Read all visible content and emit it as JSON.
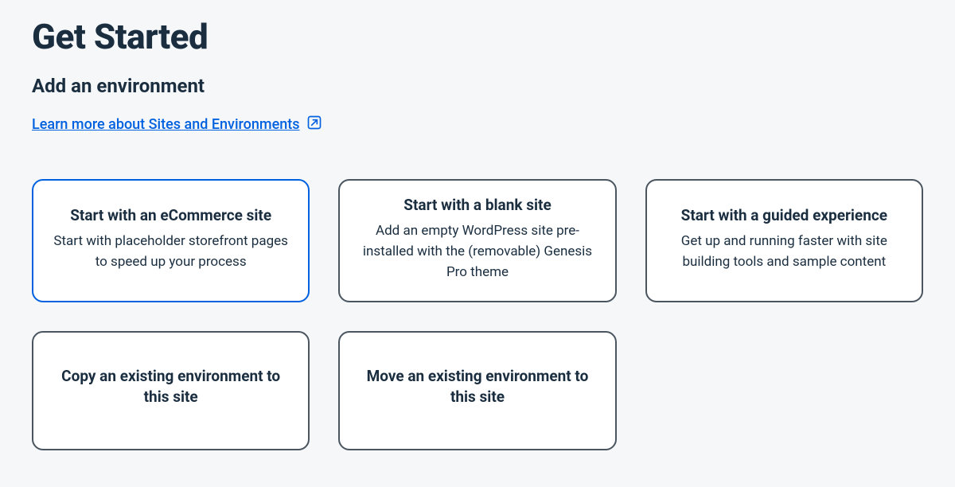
{
  "header": {
    "title": "Get Started",
    "subtitle": "Add an environment",
    "learn_link": "Learn more about Sites and Environments"
  },
  "cards": [
    {
      "title": "Start with an eCommerce site",
      "desc": "Start with placeholder storefront pages to speed up your process",
      "selected": true
    },
    {
      "title": "Start with a blank site",
      "desc": "Add an empty WordPress site pre-installed with the (removable) Genesis Pro theme",
      "selected": false
    },
    {
      "title": "Start with a guided experience",
      "desc": "Get up and running faster with site building tools and sample content",
      "selected": false
    },
    {
      "title": "Copy an existing environment to this site",
      "desc": "",
      "selected": false
    },
    {
      "title": "Move an existing environment to this site",
      "desc": "",
      "selected": false
    }
  ]
}
